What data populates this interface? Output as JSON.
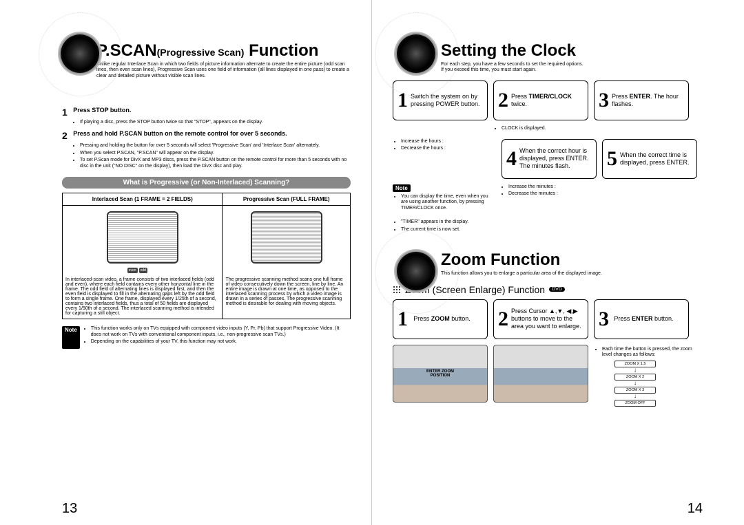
{
  "left": {
    "title_main": "P.SCAN",
    "title_sub": "(Progressive Scan)",
    "title_word": " Function",
    "intro": "Unlike regular Interlace Scan in which two fields of picture information alternate to create the entire picture (odd scan lines, then even scan lines), Progressive Scan uses one field of information (all lines displayed in one pass) to create a clear and detailed picture without visible scan lines.",
    "step1_num": "1",
    "step1_head": "Press STOP button.",
    "step1_b1": "If playing a disc, press the STOP button twice so that \"STOP\", appears on the display.",
    "step2_num": "2",
    "step2_head": "Press and hold P.SCAN button on the remote control for over 5 seconds.",
    "step2_b1": "Pressing and holding the button for over 5 seconds will select 'Progressive Scan' and 'Interlace Scan' alternately.",
    "step2_b2": "When you select P.SCAN, \"P.SCAN\" will appear on the display.",
    "step2_b3": "To set P.Scan mode for DivX and MP3 discs, press the P.SCAN button on the remote control for more than 5 seconds with no disc in the unit (\"NO DISC\" on the display), then load the DivX disc and play.",
    "bar": "What is Progressive (or Non-Interlaced) Scanning?",
    "th1": "Interlaced Scan (1 FRAME = 2 FIELDS)",
    "th2": "Progressive Scan (FULL FRAME)",
    "td1": "In interlaced-scan video, a frame consists of two interlaced fields (odd and even), where each field contains every other horizontal line in the frame. The odd field of alternating lines is displayed first, and then the even field is displayed to fill in the alternating gaps left by the odd field to form a single frame. One frame, displayed every 1/25th of a second, contains two interlaced fields, thus a total of 50 fields are displayed every 1/50th of a second. The interlaced scanning method is intended for capturing a still object.",
    "td2": "The progressive scanning method scans one full frame of video consecutively down the screen, line by line. An entire image is drawn at one time, as opposed to the interlaced scanning process by which a video image is drawn in a series of passes. The progressive scanning method is desirable for dealing with moving objects.",
    "note_label": "Note",
    "note_b1": "This function works only on TVs equipped with component video inputs (Y, Pr, Pb) that support Progressive Video. (It does not work on TVs with conventional component inputs, i.e., non-progressive scan TVs.)",
    "note_b2": "Depending on the capabilities of your TV, this function may not work.",
    "pagenum": "13"
  },
  "right": {
    "clock_title": "Setting the Clock",
    "clock_intro1": "For each step, you have a few seconds to set the required options.",
    "clock_intro2": "If you exceed this time, you must start again.",
    "s1n": "1",
    "s1": "Switch the system on by pressing POWER button.",
    "s2n": "2",
    "s2a": "Press ",
    "s2b": "TIMER/CLOCK",
    "s2c": " twice.",
    "s3n": "3",
    "s3a": "Press ",
    "s3b": "ENTER",
    "s3c": ". The hour flashes.",
    "s2_note": "CLOCK is displayed.",
    "s3_note1": "Increase the hours :",
    "s3_note2": "Decrease the hours :",
    "s4n": "4",
    "s4": "When the correct hour is displayed, press ENTER. The minutes flash.",
    "s5n": "5",
    "s5": "When the correct time is displayed, press ENTER.",
    "note_label": "Note",
    "right_note_b1": "You can display the time, even when you are using another function, by pressing TIMER/CLOCK once.",
    "s4_note1": "Increase the minutes :",
    "s4_note2": "Decrease the minutes :",
    "s5_note1": "\"TIMER\" appears in the display.",
    "s5_note2": "The current time is now set.",
    "zoom_title": "Zoom Function",
    "zoom_intro": "This function allows you to enlarge a particular area of the displayed image.",
    "zoom_sub": "Zoom (Screen Enlarge) Function",
    "dvd": "DVD",
    "z1n": "1",
    "z1a": "Press ",
    "z1b": "ZOOM",
    "z1c": " button.",
    "z2n": "2",
    "z2": "Press Cursor ▲,▼, ◀,▶ buttons to move to the area you want to enlarge.",
    "z3n": "3",
    "z3a": "Press ",
    "z3b": "ENTER",
    "z3c": " button.",
    "z3_note": "Each time the button is pressed, the zoom level changes as follows:",
    "flow1": "ZOOM X 1.5",
    "flow2": "ZOOM X 2",
    "flow3": "ZOOM X 3",
    "flow4": "ZOOM OFF",
    "thumb_ov1": "ENTER ZOOM",
    "thumb_ov2": "POSITION",
    "pagenum": "14"
  }
}
